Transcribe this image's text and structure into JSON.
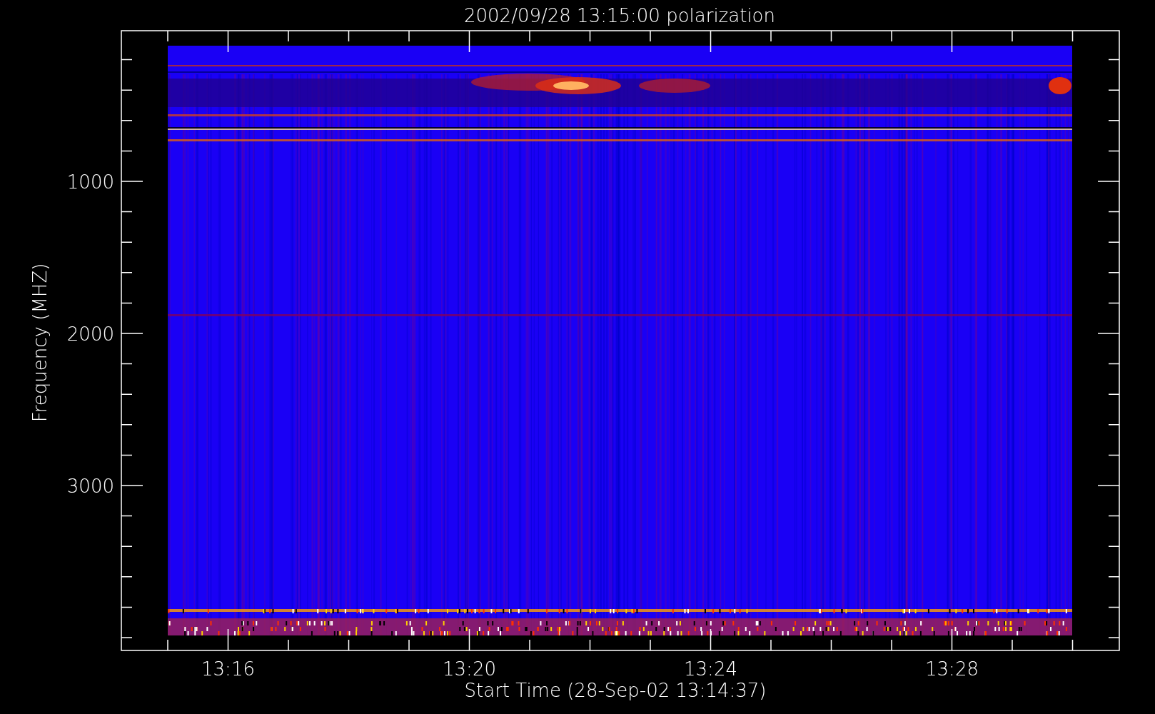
{
  "plot": {
    "title": "2002/09/28 13:15:00 polarization",
    "ylabel": "Frequency (MHZ)",
    "xlabel": "Start Time (28-Sep-02 13:14:37)",
    "x_tick_labels": [
      "13:16",
      "13:20",
      "13:24",
      "13:28"
    ],
    "y_tick_labels": [
      "1000",
      "2000",
      "3000"
    ]
  }
}
